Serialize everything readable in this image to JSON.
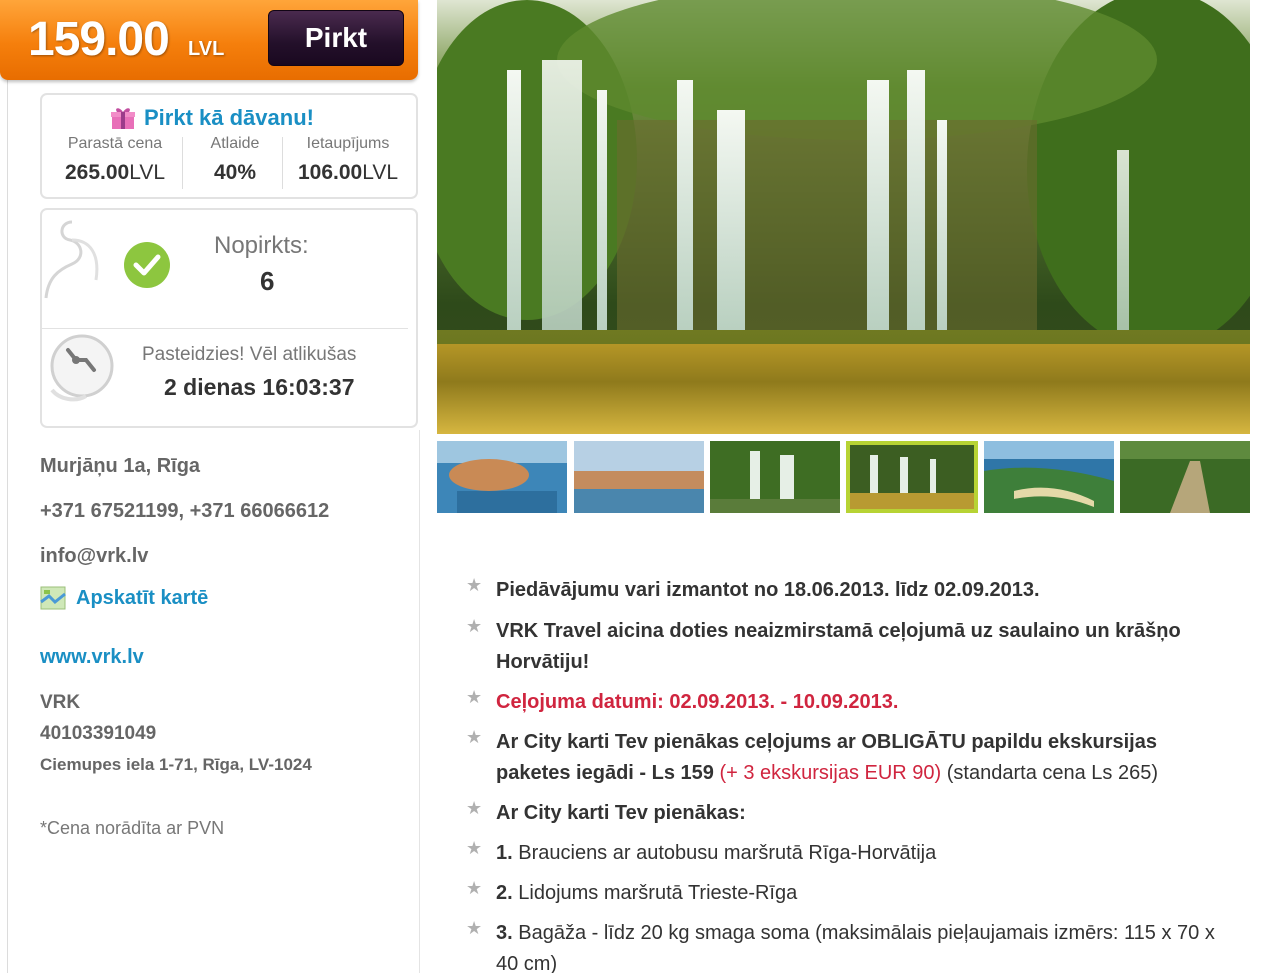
{
  "offer": {
    "price": "159.00",
    "currency": "LVL",
    "buy_label": "Pirkt",
    "gift_label": "Pirkt kā dāvanu!",
    "stats": [
      {
        "label": "Parastā cena",
        "value": "265.00",
        "unit": "LVL"
      },
      {
        "label": "Atlaide",
        "value": "40%",
        "unit": ""
      },
      {
        "label": "Ietaupījums",
        "value": "106.00",
        "unit": "LVL"
      }
    ],
    "bought_label": "Nopirkts:",
    "bought_count": "6",
    "hurry_label": "Pasteidzies! Vēl atlikušas",
    "countdown": "2 dienas 16:03:37"
  },
  "contact": {
    "address": "Murjāņu 1a, Rīga",
    "phones": "+371 67521199, +371 66066612",
    "email": "info@vrk.lv",
    "map_label": "Apskatīt kartē",
    "website": "www.vrk.lv",
    "company_name": "VRK",
    "reg_number": "40103391049",
    "legal_address": "Ciemupes iela 1-71, Rīga, LV-1024",
    "vat_note": "*Cena norādīta ar PVN"
  },
  "gallery": {
    "thumbnails": [
      "dubrovnik-harbor",
      "old-town-sea",
      "waterfalls-wide",
      "waterfalls-lake",
      "beach-bay",
      "wooden-path"
    ],
    "active_index": 3
  },
  "description": {
    "items": [
      {
        "text": "Piedāvājumu vari izmantot no 18.06.2013. līdz 02.09.2013."
      },
      {
        "text": "VRK Travel aicina doties neaizmirstamā ceļojumā uz saulaino un krāšņo Horvātiju!"
      },
      {
        "text": "Ceļojuma datumi: 02.09.2013. - 10.09.2013."
      },
      {
        "part1": "Ar City karti Tev pienākas ceļojums ar OBLIGĀTU papildu ekskursijas paketes iegādi - Ls 159",
        "part2": "(+ 3 ekskursijas EUR 90)",
        "part3": "(standarta cena Ls 265)"
      },
      {
        "text": "Ar City karti Tev pienākas:"
      },
      {
        "num": "1.",
        "text": "Brauciens ar autobusu maršrutā Rīga-Horvātija"
      },
      {
        "num": "2.",
        "text": "Lidojums maršrutā Trieste-Rīga"
      },
      {
        "num": "3.",
        "text": "Bagāža - līdz 20 kg smaga soma (maksimālais pieļaujamais izmērs: 115 x 70 x 40 cm)"
      }
    ]
  },
  "colors": {
    "price_orange": "#f57f0c",
    "buy_button": "#23102a",
    "link_blue": "#1a8fc4",
    "accent_red": "#d0253f",
    "check_green": "#8dc63f",
    "thumb_active": "#b7d334"
  }
}
